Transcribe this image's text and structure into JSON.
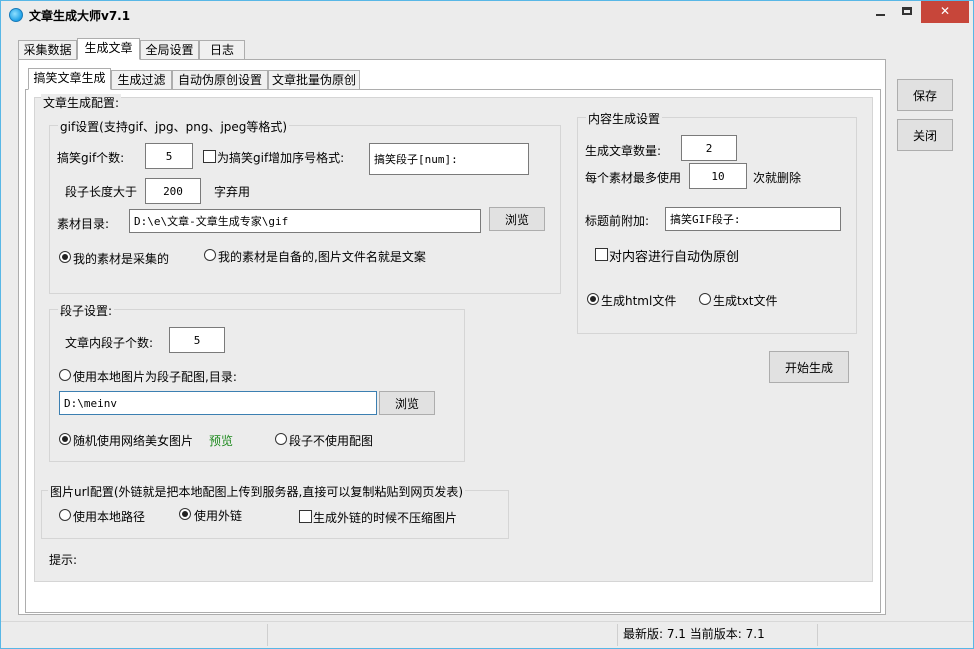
{
  "window": {
    "title": "文章生成大师v7.1",
    "minimize": "—",
    "close": "✕",
    "accent": "#58b7e6"
  },
  "main_tabs": [
    "采集数据",
    "生成文章",
    "全局设置",
    "日志"
  ],
  "sub_tabs": [
    "搞笑文章生成",
    "生成过滤",
    "自动伪原创设置",
    "文章批量伪原创"
  ],
  "config": {
    "title": "文章生成配置:",
    "gif": {
      "title": "gif设置(支持gif、jpg、png、jpeg等格式)",
      "count_label": "搞笑gif个数:",
      "count_value": "5",
      "add_seq_label": "为搞笑gif增加序号格式:",
      "seq_format_value": "搞笑段子[num]:",
      "length_label": "段子长度大于",
      "length_value": "200",
      "length_suffix": "字弃用",
      "dir_label": "素材目录:",
      "dir_value": "D:\\e\\文章-文章生成专家\\gif",
      "browse": "浏览",
      "radio_collected": "我的素材是采集的",
      "radio_self": "我的素材是自备的,图片文件名就是文案"
    },
    "duanzi": {
      "title": "段子设置:",
      "count_label": "文章内段子个数:",
      "count_value": "5",
      "local_radio": "使用本地图片为段子配图,目录:",
      "dir_value": "D:\\meinv",
      "browse": "浏览",
      "random_radio": "随机使用网络美女图片",
      "preview": "预览",
      "no_img_radio": "段子不使用配图"
    },
    "url": {
      "title": "图片url配置(外链就是把本地配图上传到服务器,直接可以复制粘贴到网页发表)",
      "local_path": "使用本地路径",
      "external": "使用外链",
      "no_compress": "生成外链的时候不压缩图片"
    },
    "hint_label": "提示:"
  },
  "content": {
    "title": "内容生成设置",
    "count_label": "生成文章数量:",
    "count_value": "2",
    "max_use_label": "每个素材最多使用",
    "max_use_value": "10",
    "max_use_suffix": "次就删除",
    "prefix_label": "标题前附加:",
    "prefix_value": "搞笑GIF段子:",
    "auto_rewrite": "对内容进行自动伪原创",
    "html_radio": "生成html文件",
    "txt_radio": "生成txt文件",
    "start_button": "开始生成"
  },
  "side": {
    "save": "保存",
    "close": "关闭"
  },
  "status": {
    "version_text": "最新版: 7.1 当前版本: 7.1"
  }
}
